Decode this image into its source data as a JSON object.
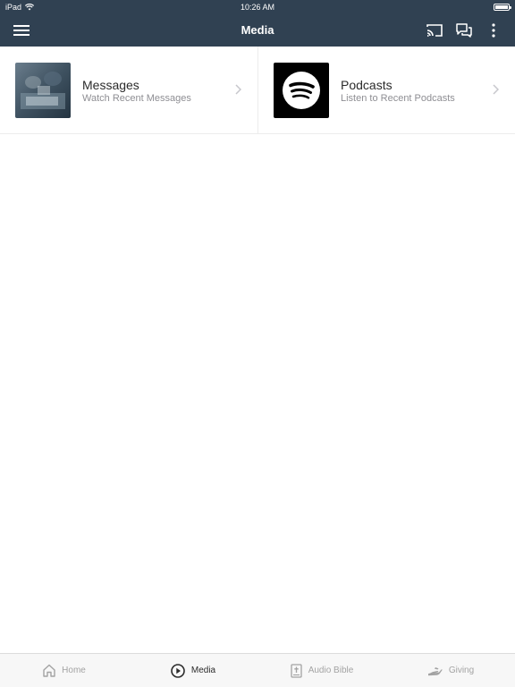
{
  "status_bar": {
    "carrier": "iPad",
    "time": "10:26 AM",
    "battery_level": 1.0
  },
  "nav_bar": {
    "title": "Media",
    "menu_icon": "hamburger-icon",
    "cast_icon": "cast-icon",
    "chat_icon": "chat-icon",
    "more_icon": "more-vertical-icon"
  },
  "tiles": [
    {
      "label": "Messages",
      "subtitle": "Watch Recent Messages",
      "icon": "messages-thumbnail"
    },
    {
      "label": "Podcasts",
      "subtitle": "Listen to Recent Podcasts",
      "icon": "spotify-icon"
    }
  ],
  "tab_bar": {
    "active": "Media",
    "items": [
      {
        "label": "Home",
        "icon": "home-icon"
      },
      {
        "label": "Media",
        "icon": "play-circle-icon"
      },
      {
        "label": "Audio Bible",
        "icon": "bible-icon"
      },
      {
        "label": "Giving",
        "icon": "giving-hand-icon"
      }
    ]
  },
  "colors": {
    "nav_background": "#304152",
    "spotify_green_bg": "#000000",
    "active_tab": "#2b2b2b",
    "inactive_tab": "#a3a3a3"
  }
}
